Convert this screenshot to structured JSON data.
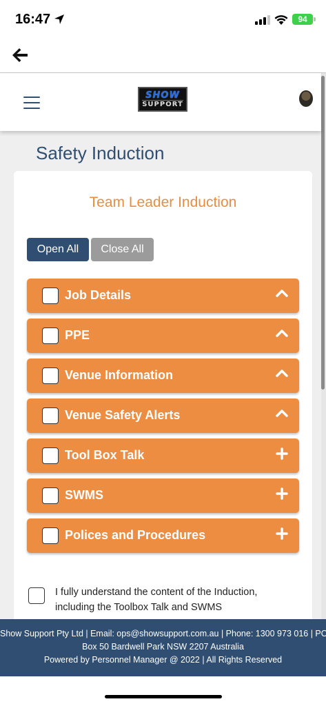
{
  "status_bar": {
    "time": "16:47",
    "battery": "94"
  },
  "header": {
    "logo_top": "SHOW",
    "logo_bottom": "SUPPORT"
  },
  "page": {
    "title": "Safety Induction",
    "card_title": "Team Leader Induction",
    "open_all": "Open All",
    "close_all": "Close All"
  },
  "sections": [
    {
      "label": "Job Details",
      "state": "expanded",
      "icon": "chevron-up-icon"
    },
    {
      "label": "PPE",
      "state": "expanded",
      "icon": "chevron-up-icon"
    },
    {
      "label": "Venue Information",
      "state": "expanded",
      "icon": "chevron-up-icon"
    },
    {
      "label": "Venue Safety Alerts",
      "state": "expanded",
      "icon": "chevron-up-icon"
    },
    {
      "label": "Tool Box Talk",
      "state": "collapsed",
      "icon": "plus-icon"
    },
    {
      "label": "SWMS",
      "state": "collapsed",
      "icon": "plus-icon"
    },
    {
      "label": "Polices and Procedures",
      "state": "collapsed",
      "icon": "plus-icon"
    }
  ],
  "agreement": {
    "line1": "I fully understand the content of the Induction,",
    "line2": "including the Toolbox Talk and SWMS"
  },
  "footer": {
    "line1": "Show Support Pty Ltd | Email: ops@showsupport.com.au | Phone: 1300 973 016 | PO",
    "line2": "Box 50 Bardwell Park NSW 2207 Australia",
    "line3": "Powered by Personnel Manager @ 2022 | All Rights Reserved"
  },
  "colors": {
    "primary": "#2f4e72",
    "accent": "#ec8d42",
    "secondary_button": "#9b9b9b",
    "battery": "#3fcf4a"
  }
}
